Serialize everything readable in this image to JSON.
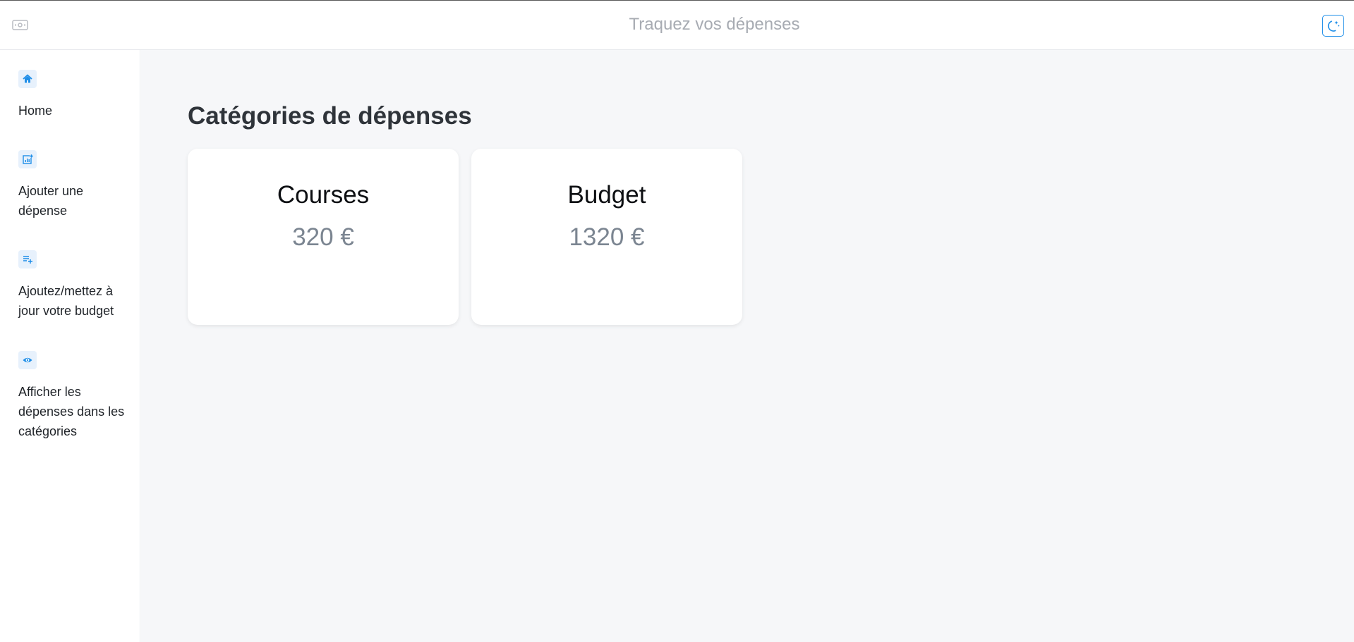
{
  "header": {
    "title": "Traquez vos dépenses",
    "logo_icon": "money-icon",
    "theme_icon": "moon-stars-icon"
  },
  "sidebar": {
    "items": [
      {
        "label": "Home",
        "icon": "home-icon"
      },
      {
        "label": "Ajouter une dépense",
        "icon": "chart-add-icon"
      },
      {
        "label": "Ajoutez/mettez à jour votre budget",
        "icon": "playlist-add-icon"
      },
      {
        "label": "Afficher les dépenses dans les catégories",
        "icon": "eye-icon"
      }
    ]
  },
  "main": {
    "title": "Catégories de dépenses",
    "cards": [
      {
        "title": "Courses",
        "value": "320 €"
      },
      {
        "title": "Budget",
        "value": "1320 €"
      }
    ]
  },
  "colors": {
    "accent": "#1e8ee8",
    "icon_bg": "#e7f1fc",
    "page_bg": "#f6f7f9"
  }
}
